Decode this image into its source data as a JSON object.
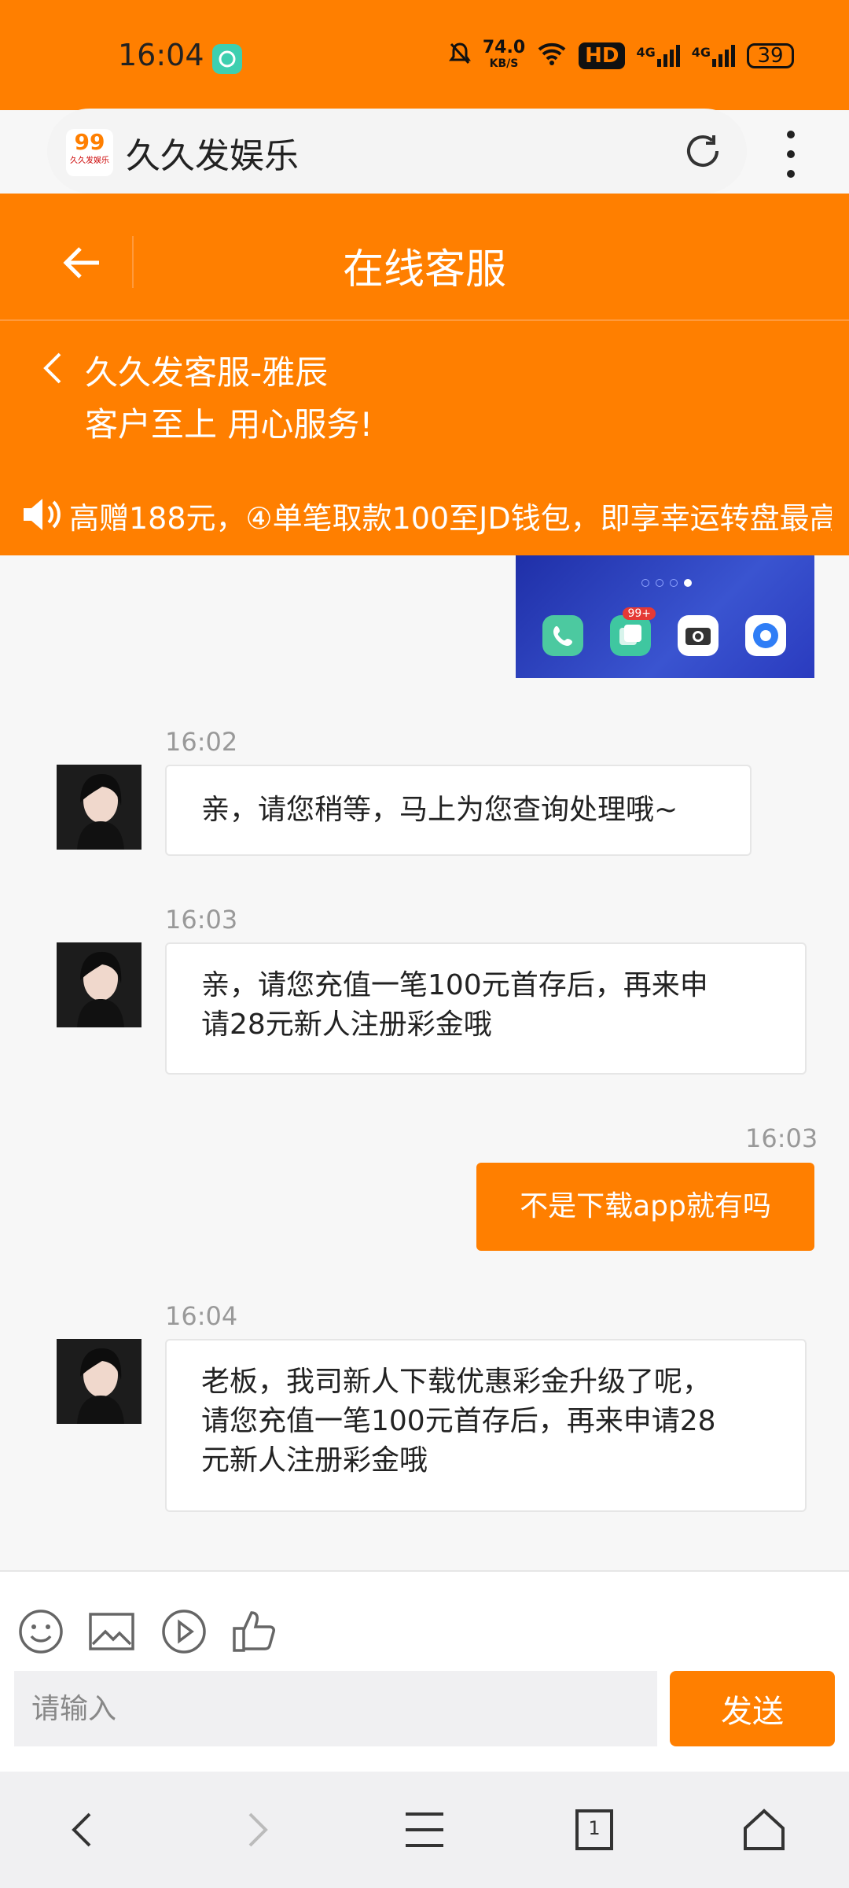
{
  "status": {
    "time": "16:04",
    "net_speed_value": "74.0",
    "net_speed_unit": "KB/S",
    "hd_label": "HD",
    "signal1": "4G",
    "signal2": "4G",
    "battery": "39"
  },
  "browser": {
    "site_title": "久久发娱乐",
    "logo_text": "99",
    "logo_subtext": "久久发娱乐"
  },
  "header": {
    "title": "在线客服"
  },
  "agent": {
    "name": "久久发客服-雅辰",
    "slogan": "客户至上 用心服务!"
  },
  "marquee": {
    "text": "高赠188元，④单笔取款100至JD钱包，即享幸运转盘最高"
  },
  "image_message": {
    "badge": "99+"
  },
  "messages": [
    {
      "time": "16:02",
      "text": "亲，请您稍等，马上为您查询处理哦~"
    },
    {
      "time": "16:03",
      "line1": "亲，请您充值一笔100元首存后，再来申",
      "line2": "请28元新人注册彩金哦"
    },
    {
      "time": "16:03",
      "text": "不是下载app就有吗"
    },
    {
      "time": "16:04",
      "line1": "老板，我司新人下载优惠彩金升级了呢，",
      "line2": "请您充值一笔100元首存后，再来申请28",
      "line3": "元新人注册彩金哦"
    }
  ],
  "composer": {
    "placeholder": "请输入",
    "send_label": "发送"
  },
  "nav": {
    "tab_count": "1"
  },
  "colors": {
    "accent": "#ff7f00",
    "bubble_bg": "#ffffff",
    "chat_bg": "#f7f7f7"
  }
}
